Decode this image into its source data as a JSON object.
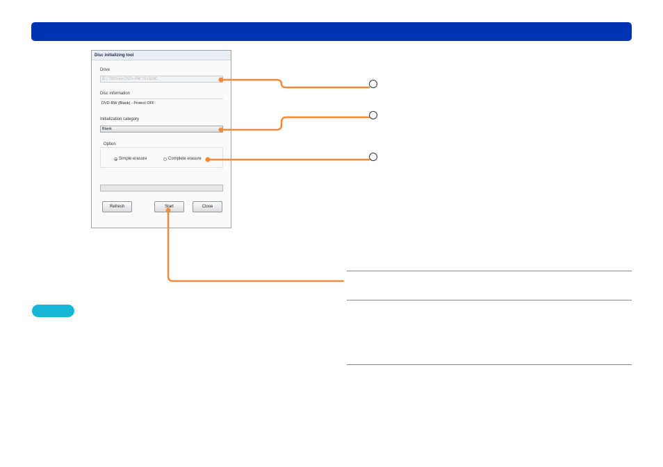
{
  "dialog": {
    "title": "Disc initializing tool",
    "drive_label": "Drive",
    "drive_value": "[E:] TSSTcorp DVD+-RW TS-L633C",
    "disc_info_label": "Disc information",
    "disc_info_value": "DVD-RW (Blank) - Protect OFF",
    "init_category_label": "Initialization category",
    "init_category_value": "Blank",
    "option_label": "Option",
    "radio_simple": "Simple erasure",
    "radio_complete": "Complete erasure",
    "buttons": {
      "refresh": "Refresh",
      "start": "Start",
      "close": "Close"
    }
  },
  "colors": {
    "header_bar": "#0033b4",
    "callout_line": "#f28a3c",
    "pill": "#15b7d4"
  },
  "icons": [
    "radio-button-selected",
    "radio-button-unselected",
    "dropdown-arrow-icon"
  ]
}
